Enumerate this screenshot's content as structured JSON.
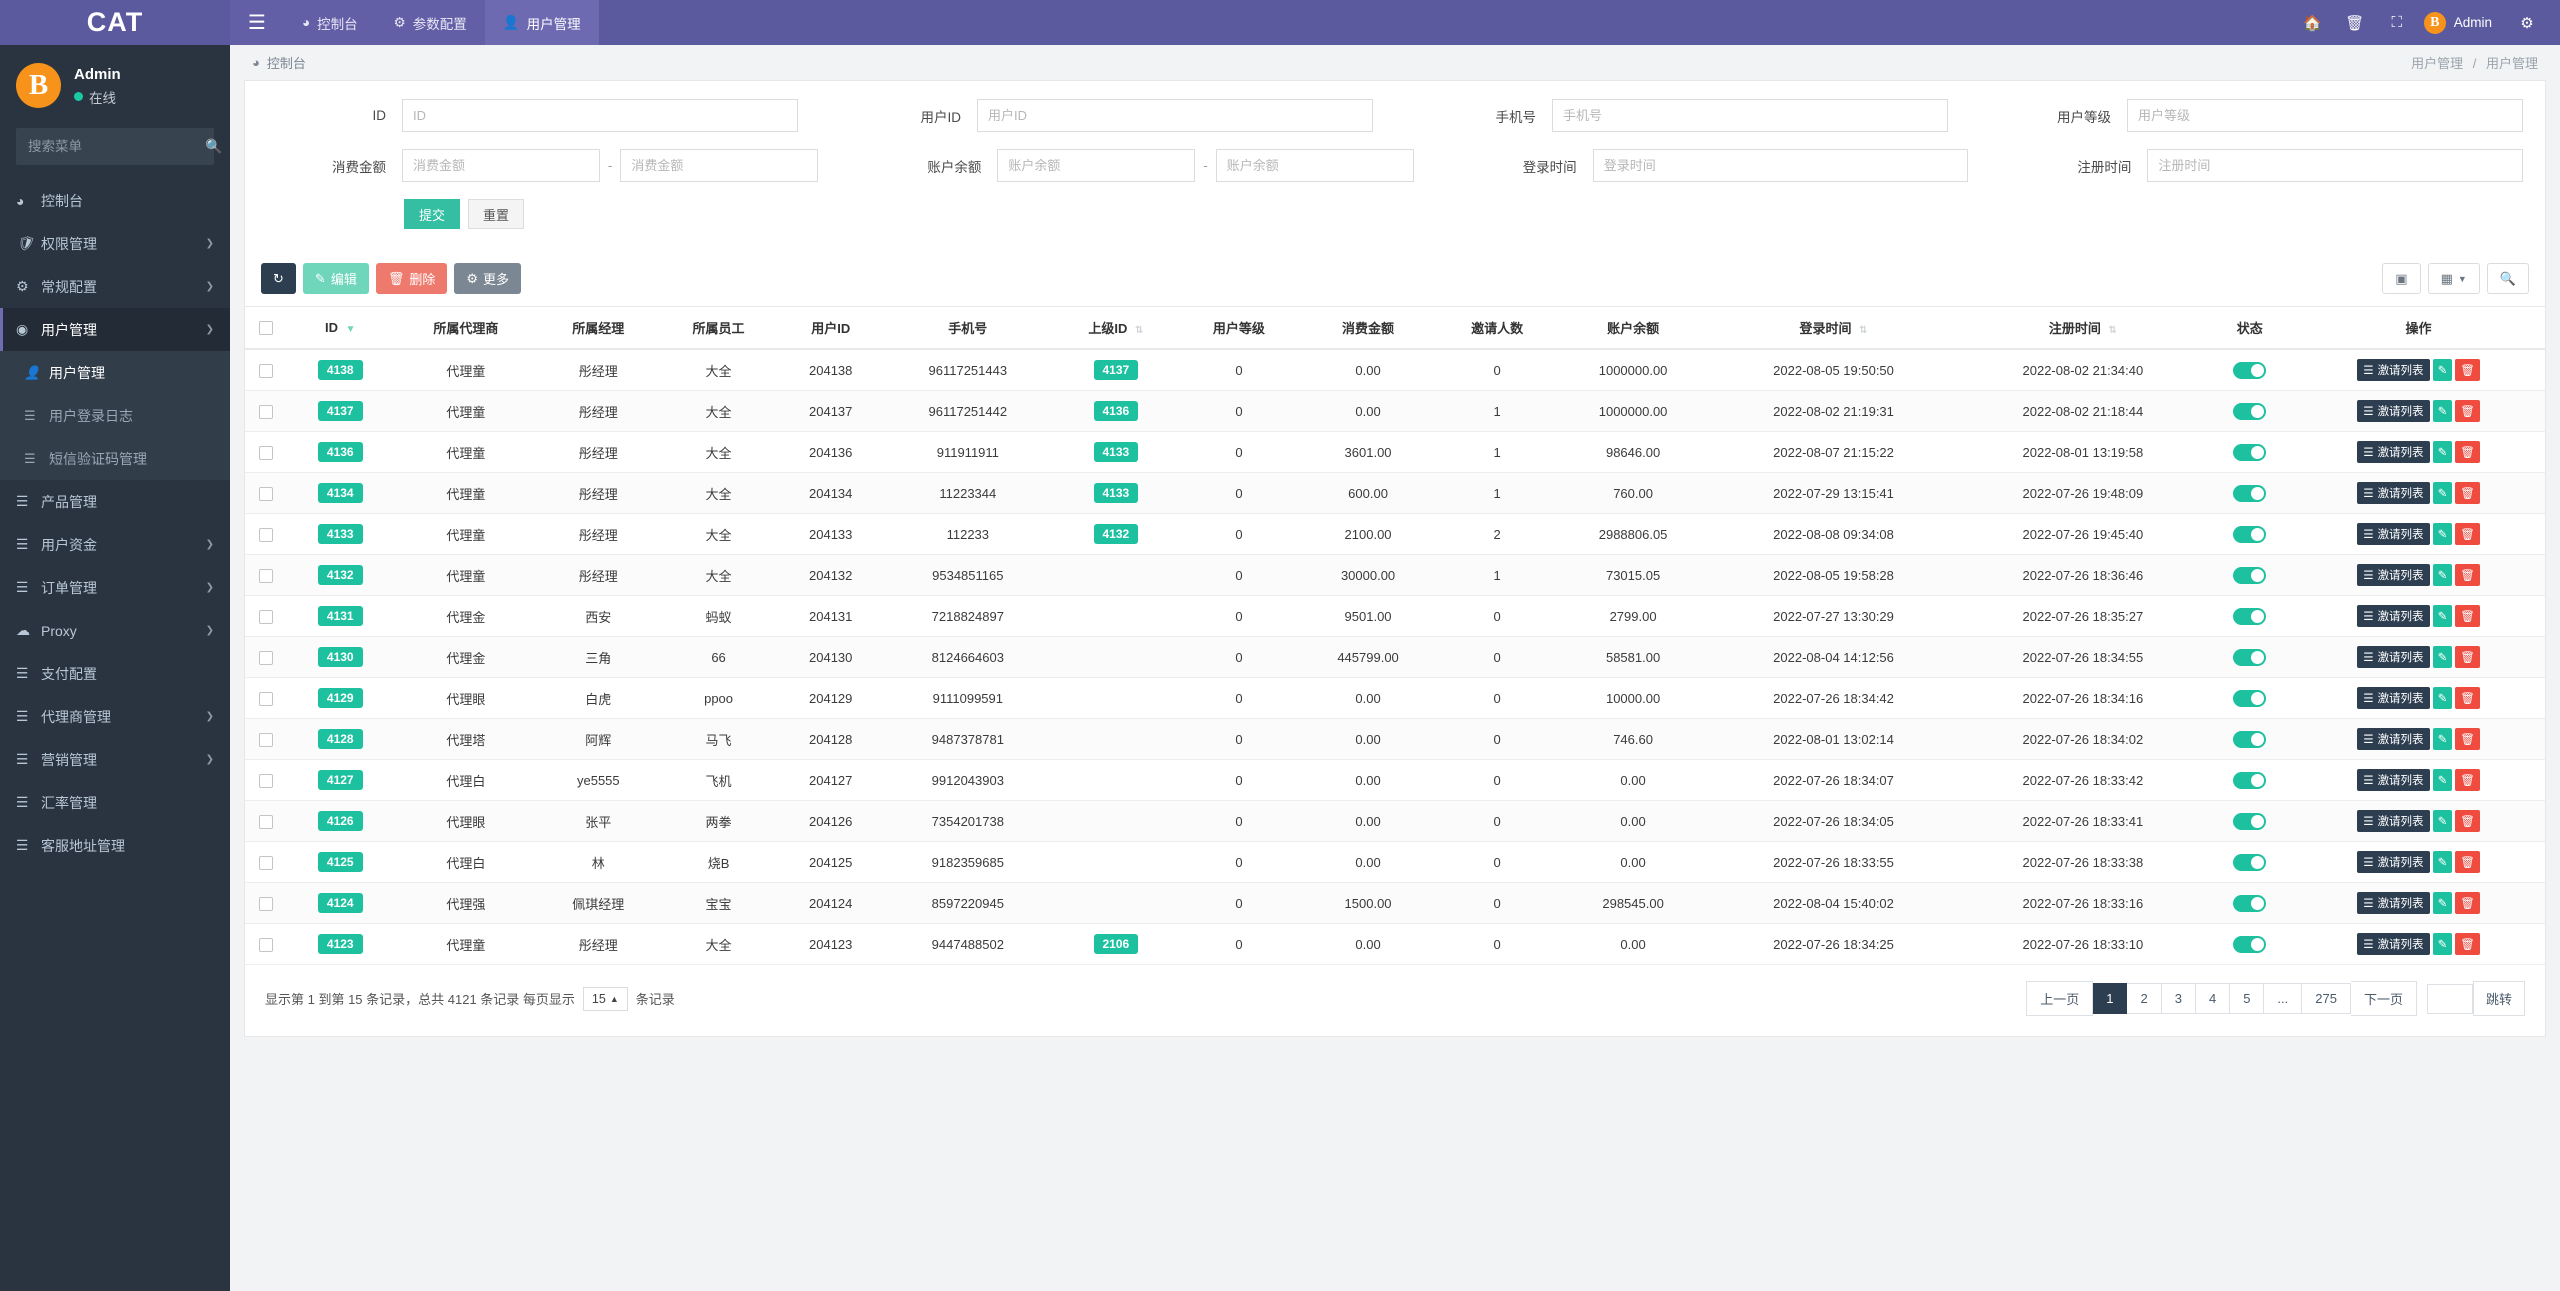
{
  "topbar": {
    "brand": "CAT",
    "menu_icon": "hamburger-icon",
    "tabs": [
      {
        "label": "控制台",
        "icon": "dashboard-icon",
        "active": false
      },
      {
        "label": "参数配置",
        "icon": "gear-icon",
        "active": false
      },
      {
        "label": "用户管理",
        "icon": "user-icon",
        "active": true
      }
    ],
    "right_icons": [
      "home-icon",
      "trash-icon",
      "fullscreen-icon",
      "settings-icon"
    ],
    "user": "Admin"
  },
  "sidebar": {
    "profile": {
      "name": "Admin",
      "status": "在线"
    },
    "search_placeholder": "搜索菜单",
    "items": [
      {
        "label": "控制台",
        "icon": "dashboard-icon",
        "arrow": false
      },
      {
        "label": "权限管理",
        "icon": "shield-icon",
        "arrow": true
      },
      {
        "label": "常规配置",
        "icon": "cogs-icon",
        "arrow": true
      },
      {
        "label": "用户管理",
        "icon": "user-circle-icon",
        "arrow": true,
        "open": true
      },
      {
        "label": "产品管理",
        "icon": "list-icon",
        "arrow": false
      },
      {
        "label": "用户资金",
        "icon": "list-icon",
        "arrow": true
      },
      {
        "label": "订单管理",
        "icon": "list-icon",
        "arrow": true
      },
      {
        "label": "Proxy",
        "icon": "cloud-icon",
        "arrow": true
      },
      {
        "label": "支付配置",
        "icon": "list-icon",
        "arrow": false
      },
      {
        "label": "代理商管理",
        "icon": "list-icon",
        "arrow": true
      },
      {
        "label": "营销管理",
        "icon": "list-icon",
        "arrow": true
      },
      {
        "label": "汇率管理",
        "icon": "list-icon",
        "arrow": false
      },
      {
        "label": "客服地址管理",
        "icon": "list-icon",
        "arrow": false
      }
    ],
    "submenu": [
      {
        "label": "用户管理",
        "icon": "user-solid-icon",
        "active": true
      },
      {
        "label": "用户登录日志",
        "icon": "list-icon",
        "active": false
      },
      {
        "label": "短信验证码管理",
        "icon": "list-icon",
        "active": false
      }
    ]
  },
  "breadcrumb": {
    "current": "控制台",
    "icon": "dashboard-icon",
    "right_first": "用户管理",
    "right_sep": "/",
    "right_last": "用户管理"
  },
  "filters": {
    "row1": [
      {
        "label": "ID",
        "placeholder": "ID",
        "value": ""
      },
      {
        "label": "用户ID",
        "placeholder": "用户ID",
        "value": ""
      },
      {
        "label": "手机号",
        "placeholder": "手机号",
        "value": ""
      },
      {
        "label": "用户等级",
        "placeholder": "用户等级",
        "value": ""
      }
    ],
    "row2": [
      {
        "label": "消费金额",
        "placeholder": "消费金额",
        "placeholder2": "消费金额",
        "range": true
      },
      {
        "label": "账户余额",
        "placeholder": "账户余额",
        "placeholder2": "账户余额",
        "range": true
      },
      {
        "label": "登录时间",
        "placeholder": "登录时间",
        "range": false
      },
      {
        "label": "注册时间",
        "placeholder": "注册时间",
        "range": false
      }
    ],
    "submit": "提交",
    "reset": "重置"
  },
  "toolbar": {
    "refresh_icon": "refresh-icon",
    "edit": "编辑",
    "delete": "删除",
    "more": "更多",
    "columns_icon": "columns-icon",
    "grid_icon": "grid-icon",
    "search_icon": "search-icon"
  },
  "table": {
    "columns": [
      {
        "label": "",
        "key": "check"
      },
      {
        "label": "ID",
        "key": "id",
        "sort": "desc"
      },
      {
        "label": "所属代理商",
        "key": "agent"
      },
      {
        "label": "所属经理",
        "key": "manager"
      },
      {
        "label": "所属员工",
        "key": "staff"
      },
      {
        "label": "用户ID",
        "key": "uid"
      },
      {
        "label": "手机号",
        "key": "phone"
      },
      {
        "label": "上级ID",
        "key": "parent",
        "sort": "both"
      },
      {
        "label": "用户等级",
        "key": "level"
      },
      {
        "label": "消费金额",
        "key": "spend"
      },
      {
        "label": "邀请人数",
        "key": "invites"
      },
      {
        "label": "账户余额",
        "key": "balance"
      },
      {
        "label": "登录时间",
        "key": "login_time",
        "sort": "both"
      },
      {
        "label": "注册时间",
        "key": "reg_time",
        "sort": "both"
      },
      {
        "label": "状态",
        "key": "status"
      },
      {
        "label": "操作",
        "key": "ops"
      }
    ],
    "op_labels": {
      "list": "激请列表",
      "edit_icon": "pencil-icon",
      "del_icon": "trash-icon",
      "list_icon": "list-icon"
    },
    "rows": [
      {
        "id": "4138",
        "agent": "代理童",
        "manager": "彤经理",
        "staff": "大全",
        "uid": "204138",
        "phone": "96117251443",
        "parent": "4137",
        "level": "0",
        "spend": "0.00",
        "invites": "0",
        "balance": "1000000.00",
        "login_time": "2022-08-05 19:50:50",
        "reg_time": "2022-08-02 21:34:40"
      },
      {
        "id": "4137",
        "agent": "代理童",
        "manager": "彤经理",
        "staff": "大全",
        "uid": "204137",
        "phone": "96117251442",
        "parent": "4136",
        "level": "0",
        "spend": "0.00",
        "invites": "1",
        "balance": "1000000.00",
        "login_time": "2022-08-02 21:19:31",
        "reg_time": "2022-08-02 21:18:44"
      },
      {
        "id": "4136",
        "agent": "代理童",
        "manager": "彤经理",
        "staff": "大全",
        "uid": "204136",
        "phone": "911911911",
        "parent": "4133",
        "level": "0",
        "spend": "3601.00",
        "invites": "1",
        "balance": "98646.00",
        "login_time": "2022-08-07 21:15:22",
        "reg_time": "2022-08-01 13:19:58"
      },
      {
        "id": "4134",
        "agent": "代理童",
        "manager": "彤经理",
        "staff": "大全",
        "uid": "204134",
        "phone": "11223344",
        "parent": "4133",
        "level": "0",
        "spend": "600.00",
        "invites": "1",
        "balance": "760.00",
        "login_time": "2022-07-29 13:15:41",
        "reg_time": "2022-07-26 19:48:09"
      },
      {
        "id": "4133",
        "agent": "代理童",
        "manager": "彤经理",
        "staff": "大全",
        "uid": "204133",
        "phone": "112233",
        "parent": "4132",
        "level": "0",
        "spend": "2100.00",
        "invites": "2",
        "balance": "2988806.05",
        "login_time": "2022-08-08 09:34:08",
        "reg_time": "2022-07-26 19:45:40"
      },
      {
        "id": "4132",
        "agent": "代理童",
        "manager": "彤经理",
        "staff": "大全",
        "uid": "204132",
        "phone": "9534851165",
        "parent": "",
        "level": "0",
        "spend": "30000.00",
        "invites": "1",
        "balance": "73015.05",
        "login_time": "2022-08-05 19:58:28",
        "reg_time": "2022-07-26 18:36:46"
      },
      {
        "id": "4131",
        "agent": "代理金",
        "manager": "西安",
        "staff": "蚂蚁",
        "uid": "204131",
        "phone": "7218824897",
        "parent": "",
        "level": "0",
        "spend": "9501.00",
        "invites": "0",
        "balance": "2799.00",
        "login_time": "2022-07-27 13:30:29",
        "reg_time": "2022-07-26 18:35:27"
      },
      {
        "id": "4130",
        "agent": "代理金",
        "manager": "三角",
        "staff": "66",
        "uid": "204130",
        "phone": "8124664603",
        "parent": "",
        "level": "0",
        "spend": "445799.00",
        "invites": "0",
        "balance": "58581.00",
        "login_time": "2022-08-04 14:12:56",
        "reg_time": "2022-07-26 18:34:55"
      },
      {
        "id": "4129",
        "agent": "代理眼",
        "manager": "白虎",
        "staff": "ppoo",
        "uid": "204129",
        "phone": "9111099591",
        "parent": "",
        "level": "0",
        "spend": "0.00",
        "invites": "0",
        "balance": "10000.00",
        "login_time": "2022-07-26 18:34:42",
        "reg_time": "2022-07-26 18:34:16"
      },
      {
        "id": "4128",
        "agent": "代理塔",
        "manager": "阿辉",
        "staff": "马飞",
        "uid": "204128",
        "phone": "9487378781",
        "parent": "",
        "level": "0",
        "spend": "0.00",
        "invites": "0",
        "balance": "746.60",
        "login_time": "2022-08-01 13:02:14",
        "reg_time": "2022-07-26 18:34:02"
      },
      {
        "id": "4127",
        "agent": "代理白",
        "manager": "ye5555",
        "staff": "飞机",
        "uid": "204127",
        "phone": "9912043903",
        "parent": "",
        "level": "0",
        "spend": "0.00",
        "invites": "0",
        "balance": "0.00",
        "login_time": "2022-07-26 18:34:07",
        "reg_time": "2022-07-26 18:33:42"
      },
      {
        "id": "4126",
        "agent": "代理眼",
        "manager": "张平",
        "staff": "两拳",
        "uid": "204126",
        "phone": "7354201738",
        "parent": "",
        "level": "0",
        "spend": "0.00",
        "invites": "0",
        "balance": "0.00",
        "login_time": "2022-07-26 18:34:05",
        "reg_time": "2022-07-26 18:33:41"
      },
      {
        "id": "4125",
        "agent": "代理白",
        "manager": "林",
        "staff": "烧B",
        "uid": "204125",
        "phone": "9182359685",
        "parent": "",
        "level": "0",
        "spend": "0.00",
        "invites": "0",
        "balance": "0.00",
        "login_time": "2022-07-26 18:33:55",
        "reg_time": "2022-07-26 18:33:38"
      },
      {
        "id": "4124",
        "agent": "代理强",
        "manager": "佩琪经理",
        "staff": "宝宝",
        "uid": "204124",
        "phone": "8597220945",
        "parent": "",
        "level": "0",
        "spend": "1500.00",
        "invites": "0",
        "balance": "298545.00",
        "login_time": "2022-08-04 15:40:02",
        "reg_time": "2022-07-26 18:33:16"
      },
      {
        "id": "4123",
        "agent": "代理童",
        "manager": "彤经理",
        "staff": "大全",
        "uid": "204123",
        "phone": "9447488502",
        "parent": "2106",
        "level": "0",
        "spend": "0.00",
        "invites": "0",
        "balance": "0.00",
        "login_time": "2022-07-26 18:34:25",
        "reg_time": "2022-07-26 18:33:10"
      }
    ]
  },
  "footer": {
    "info": "显示第 1 到第 15 条记录，总共 4121 条记录 每页显示",
    "page_size": "15",
    "info_suffix": "条记录",
    "pagination": {
      "prev": "上一页",
      "pages": [
        "1",
        "2",
        "3",
        "4",
        "5",
        "...",
        "275"
      ],
      "current": "1",
      "next": "下一页",
      "jump_value": "",
      "jump_label": "跳转"
    }
  }
}
